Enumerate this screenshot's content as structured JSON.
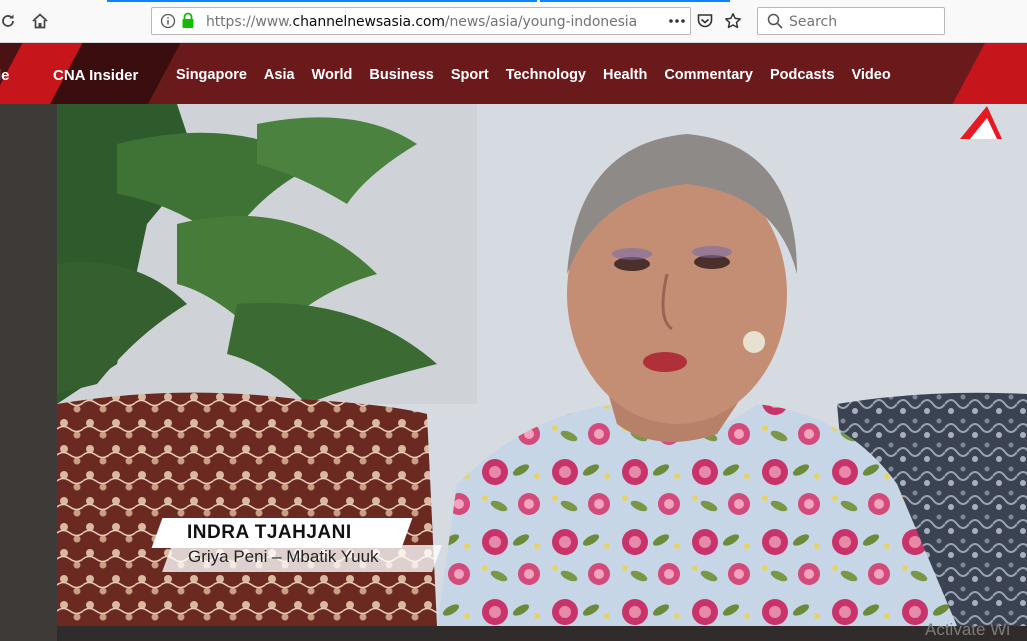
{
  "browser": {
    "url_prefix": "https://www.",
    "url_host": "channelnewsasia.com",
    "url_path": "/news/asia/young-indonesians-help",
    "search_placeholder": "Search",
    "reload_icon": "reload-icon",
    "home_icon": "home-icon",
    "info_icon": "info-icon",
    "lock_icon": "lock-icon",
    "more_icon": "more-actions-icon",
    "pocket_icon": "pocket-icon",
    "bookmark_icon": "bookmark-star-icon",
    "search_icon": "search-icon"
  },
  "site_nav": {
    "left_partial": "le",
    "insider": "CNA Insider",
    "items": [
      "Singapore",
      "Asia",
      "World",
      "Business",
      "Sport",
      "Technology",
      "Health",
      "Commentary",
      "Podcasts",
      "Video"
    ],
    "logo": "cna-logo-icon"
  },
  "video": {
    "lower_third_name": "INDRA TJAHJANI",
    "lower_third_org": "Griya Peni – Mbatik Yuuk"
  },
  "os_watermark": "Activate Wi",
  "colors": {
    "nav_bg": "#6b1a1c",
    "nav_accent": "#c7151c",
    "lock_green": "#12bc00"
  }
}
